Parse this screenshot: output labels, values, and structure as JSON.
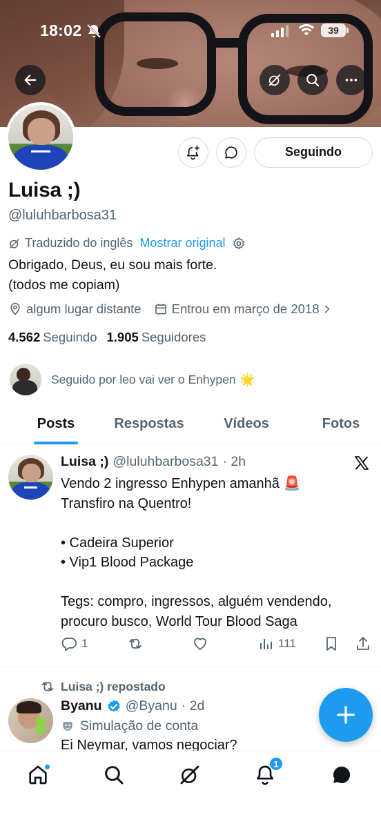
{
  "status_bar": {
    "time": "18:02",
    "battery": "39"
  },
  "profile": {
    "name": "Luisa ;)",
    "handle": "@luluhbarbosa31",
    "translated_label": "Traduzido do inglês",
    "show_original": "Mostrar original",
    "bio_line1": "Obrigado, Deus, eu sou mais forte.",
    "bio_line2": "(todos me copiam)",
    "location": "algum lugar distante",
    "joined": "Entrou em março de 2018",
    "following_count": "4.562",
    "following_label": "Seguindo",
    "followers_count": "1.905",
    "followers_label": "Seguidores",
    "followed_by": "Seguido por leo vai ver o Enhypen",
    "followed_by_emoji": "🌟",
    "follow_button": "Seguindo"
  },
  "tabs": [
    "Posts",
    "Respostas",
    "Vídeos",
    "Fotos"
  ],
  "tweet": {
    "name": "Luisa ;)",
    "handle": "@luluhbarbosa31",
    "time": "· 2h",
    "text": "Vendo 2 ingresso Enhypen amanhã 🚨\nTransfiro na Quentro!\n\n• Cadeira Superior\n• Vip1 Blood Package\n\nTegs: compro, ingressos, alguém vendendo,\nprocuro busco, World Tour Blood Saga",
    "replies": "1",
    "reposts": "",
    "likes": "",
    "views": "111"
  },
  "repost": {
    "label": "Luisa ;) repostado",
    "name": "Byanu",
    "handle": "@Byanu",
    "time": "· 2d",
    "simulation": "Simulação de conta",
    "text": "Ei Neymar, vamos negociar?"
  },
  "nav": {
    "notifications_badge": "1"
  },
  "colors": {
    "accent": "#1d9bf0",
    "text": "#0f1419",
    "secondary": "#536471",
    "border": "#cfd9de"
  },
  "icons": [
    "back-arrow-icon",
    "grok-icon",
    "search-icon",
    "more-icon",
    "bell-plus-icon",
    "message-icon",
    "gear-icon",
    "location-icon",
    "calendar-icon",
    "x-logo-icon",
    "reply-icon",
    "repost-icon",
    "like-icon",
    "views-icon",
    "bookmark-icon",
    "share-icon",
    "verified-icon",
    "plus-icon",
    "home-icon",
    "bell-icon",
    "envelope-icon"
  ]
}
